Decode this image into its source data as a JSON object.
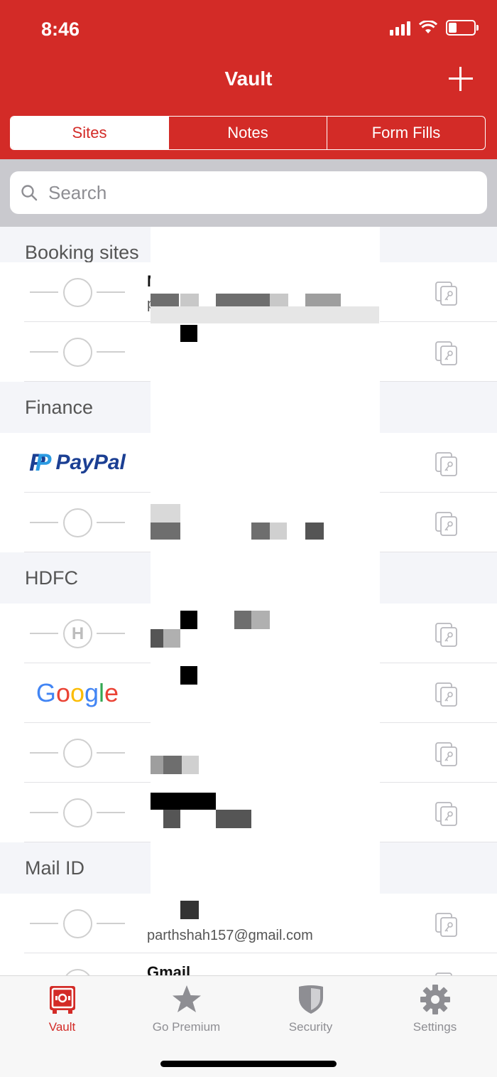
{
  "status_bar": {
    "time": "8:46"
  },
  "header": {
    "title": "Vault"
  },
  "segments": [
    "Sites",
    "Notes",
    "Form Fills"
  ],
  "search": {
    "placeholder": "Search"
  },
  "sections": [
    {
      "title": "Booking sites",
      "rows": [
        {
          "logo": "placeholder",
          "name": "Mobi freecharge",
          "username": "parthshah1615@outlook.com"
        },
        {
          "logo": "placeholder",
          "name": "",
          "username": ""
        }
      ]
    },
    {
      "title": "Finance",
      "rows": [
        {
          "logo": "paypal",
          "name": "",
          "username": ""
        },
        {
          "logo": "placeholder",
          "name": "",
          "username": ""
        }
      ]
    },
    {
      "title": "HDFC",
      "rows": [
        {
          "logo": "h",
          "name": "",
          "username": ""
        },
        {
          "logo": "google",
          "name": "",
          "username": ""
        },
        {
          "logo": "placeholder",
          "name": "",
          "username": ""
        },
        {
          "logo": "placeholder",
          "name": "",
          "username": ""
        }
      ]
    },
    {
      "title": "Mail ID",
      "rows": [
        {
          "logo": "placeholder",
          "name": "",
          "username": "parthshah157@gmail.com"
        },
        {
          "logo": "placeholder",
          "name": "Gmail",
          "username": ""
        }
      ]
    }
  ],
  "logos": {
    "paypal": "PayPal",
    "google": "Google",
    "h": "H"
  },
  "tabs": [
    {
      "label": "Vault",
      "icon": "vault-icon",
      "active": true
    },
    {
      "label": "Go Premium",
      "icon": "star-icon",
      "active": false
    },
    {
      "label": "Security",
      "icon": "shield-icon",
      "active": false
    },
    {
      "label": "Settings",
      "icon": "gear-icon",
      "active": false
    }
  ],
  "colors": {
    "brand_red": "#d32b27",
    "tab_inactive": "#8e8e93",
    "section_bg": "#f4f5f9"
  }
}
